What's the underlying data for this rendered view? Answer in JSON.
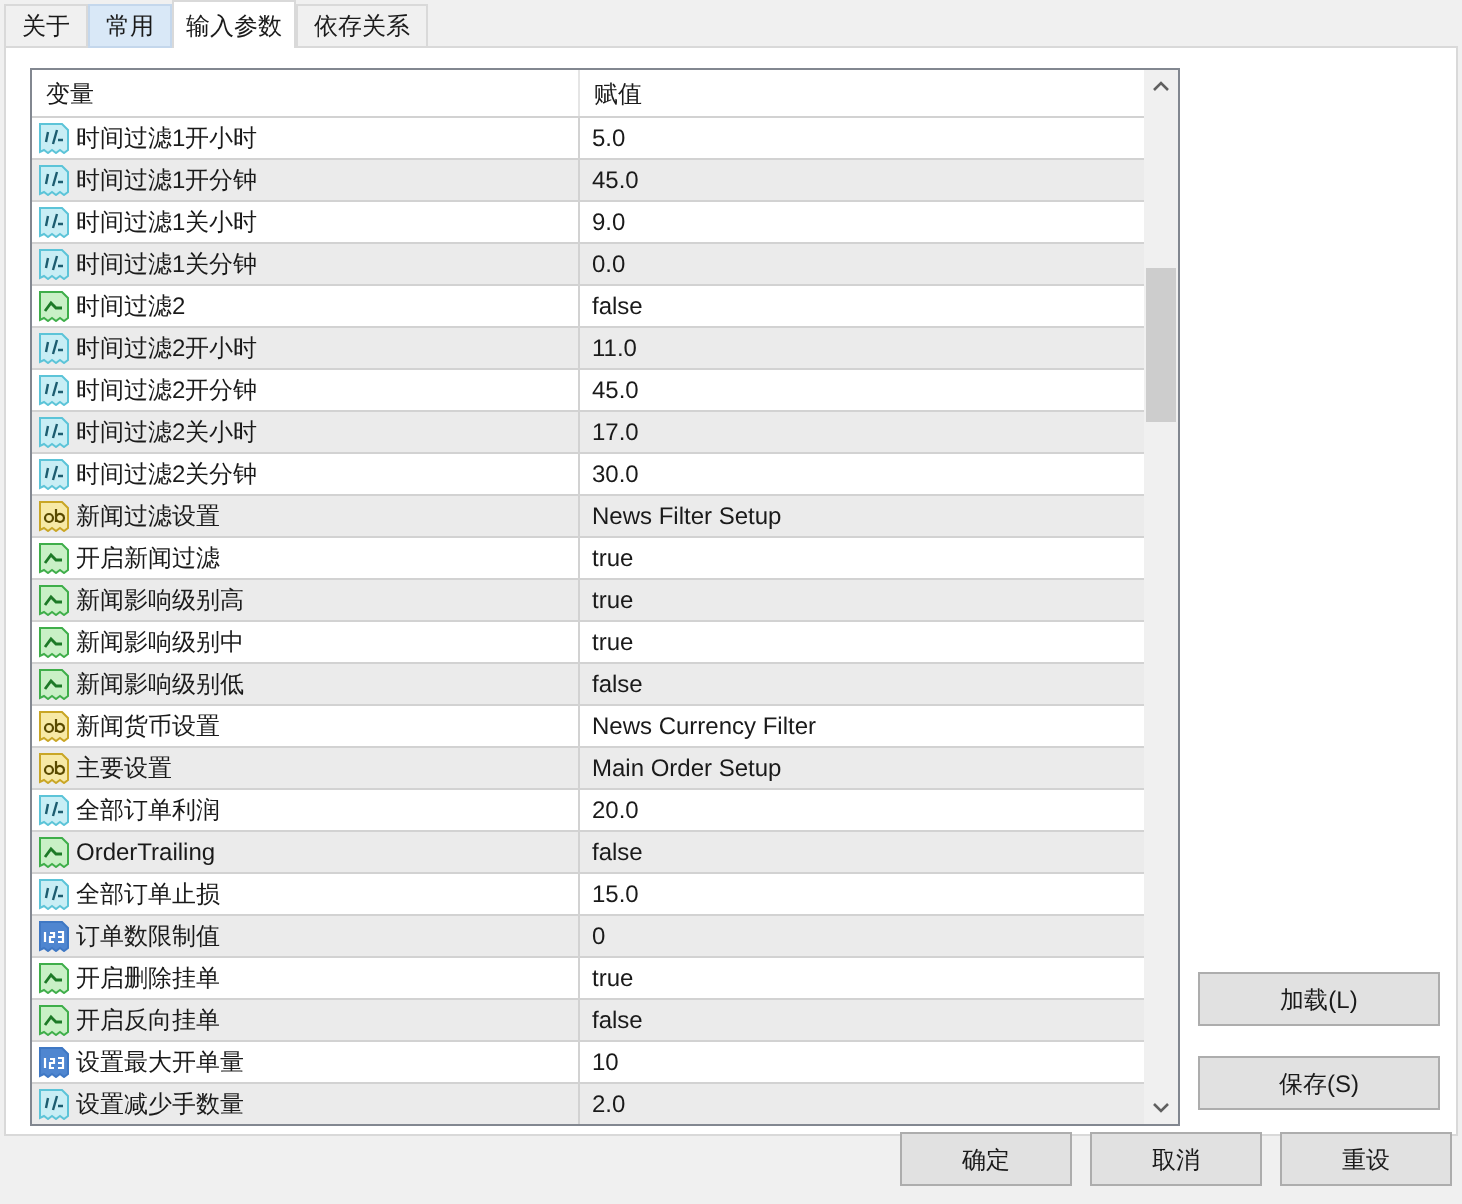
{
  "tabs": [
    {
      "label": "关于",
      "selected": false,
      "highlighted": false
    },
    {
      "label": "常用",
      "selected": false,
      "highlighted": true
    },
    {
      "label": "输入参数",
      "selected": true,
      "highlighted": false
    },
    {
      "label": "依存关系",
      "selected": false,
      "highlighted": false
    }
  ],
  "table": {
    "columns": [
      "变量",
      "赋值"
    ],
    "rows": [
      {
        "kind": "double",
        "name": "时间过滤1开小时",
        "value": "5.0"
      },
      {
        "kind": "double",
        "name": "时间过滤1开分钟",
        "value": "45.0"
      },
      {
        "kind": "double",
        "name": "时间过滤1关小时",
        "value": "9.0"
      },
      {
        "kind": "double",
        "name": "时间过滤1关分钟",
        "value": "0.0"
      },
      {
        "kind": "bool",
        "name": "时间过滤2",
        "value": "false"
      },
      {
        "kind": "double",
        "name": "时间过滤2开小时",
        "value": "11.0"
      },
      {
        "kind": "double",
        "name": "时间过滤2开分钟",
        "value": "45.0"
      },
      {
        "kind": "double",
        "name": "时间过滤2关小时",
        "value": "17.0"
      },
      {
        "kind": "double",
        "name": "时间过滤2关分钟",
        "value": "30.0"
      },
      {
        "kind": "string",
        "name": "新闻过滤设置",
        "value": "News Filter Setup"
      },
      {
        "kind": "bool",
        "name": "开启新闻过滤",
        "value": "true"
      },
      {
        "kind": "bool",
        "name": "新闻影响级别高",
        "value": "true"
      },
      {
        "kind": "bool",
        "name": "新闻影响级别中",
        "value": "true"
      },
      {
        "kind": "bool",
        "name": "新闻影响级别低",
        "value": "false"
      },
      {
        "kind": "string",
        "name": "新闻货币设置",
        "value": "News Currency Filter"
      },
      {
        "kind": "string",
        "name": "主要设置",
        "value": "Main Order Setup"
      },
      {
        "kind": "double",
        "name": "全部订单利润",
        "value": "20.0"
      },
      {
        "kind": "bool",
        "name": "OrderTrailing",
        "value": "false"
      },
      {
        "kind": "double",
        "name": "全部订单止损",
        "value": "15.0"
      },
      {
        "kind": "int",
        "name": "订单数限制值",
        "value": "0"
      },
      {
        "kind": "bool",
        "name": "开启删除挂单",
        "value": "true"
      },
      {
        "kind": "bool",
        "name": "开启反向挂单",
        "value": "false"
      },
      {
        "kind": "int",
        "name": "设置最大开单量",
        "value": "10"
      },
      {
        "kind": "double",
        "name": "设置减少手数量",
        "value": "2.0"
      }
    ]
  },
  "side_buttons": [
    "加载(L)",
    "保存(S)"
  ],
  "bottom_buttons": [
    "确定",
    "取消",
    "重设"
  ]
}
